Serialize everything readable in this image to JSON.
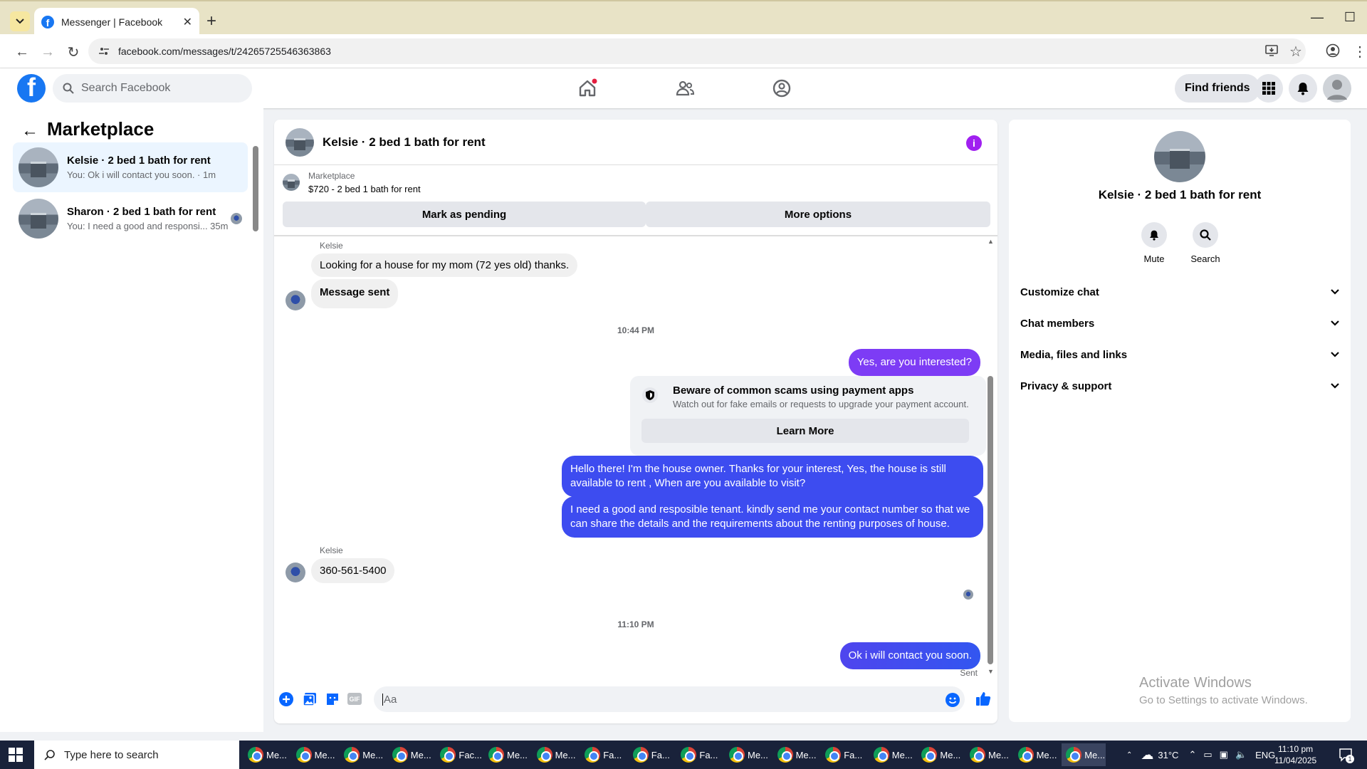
{
  "browser": {
    "tab_title": "Messenger | Facebook",
    "url": "facebook.com/messages/t/24265725546363863"
  },
  "header": {
    "search_placeholder": "Search Facebook",
    "find_friends": "Find friends"
  },
  "sidebar": {
    "title": "Marketplace",
    "conversations": [
      {
        "name": "Kelsie · 2 bed 1 bath for rent",
        "preview": "You: Ok i will contact you soon. · 1m"
      },
      {
        "name": "Sharon · 2 bed 1 bath for rent",
        "preview": "You: I need a good and responsi... 35m"
      }
    ]
  },
  "chat": {
    "title": "Kelsie · 2 bed 1 bath for rent",
    "marketplace_label": "Marketplace",
    "listing": "$720 - 2 bed 1 bath for rent",
    "mark_pending": "Mark as pending",
    "more_options": "More options",
    "sender": "Kelsie",
    "msg1": "Looking for a house for my mom (72 yes old) thanks.",
    "msg2": "Message sent",
    "time1": "10:44 PM",
    "out1": "Yes, are you interested?",
    "scam_title": "Beware of common scams using payment apps",
    "scam_desc": "Watch out for fake emails or requests to upgrade your payment account.",
    "learn_more": "Learn More",
    "out2": "Hello there! I'm the house owner. Thanks for your interest, Yes, the house is still available to rent , When are you available to visit?",
    "out3": "I need a good and resposible tenant.  kindly send me your contact number so that we can share the details and the requirements about the renting purposes of house.",
    "msg3": "360-561-5400",
    "time2": "11:10 PM",
    "out4": "Ok i will contact you soon.",
    "status": "Sent",
    "input_placeholder": "Aa"
  },
  "info_panel": {
    "name": "Kelsie · 2 bed 1 bath for rent",
    "mute": "Mute",
    "search": "Search",
    "sections": [
      "Customize chat",
      "Chat members",
      "Media, files and links",
      "Privacy & support"
    ]
  },
  "watermark": {
    "line1": "Activate Windows",
    "line2": "Go to Settings to activate Windows."
  },
  "taskbar": {
    "search_placeholder": "Type here to search",
    "apps": [
      "Me...",
      "Me...",
      "Me...",
      "Me...",
      "Fac...",
      "Me...",
      "Me...",
      "Fa...",
      "Fa...",
      "Fa...",
      "Me...",
      "Me...",
      "Fa...",
      "Me...",
      "Me...",
      "Me...",
      "Me...",
      "Me..."
    ],
    "temperature": "31°C",
    "language": "ENG",
    "time": "11:10 pm",
    "date": "11/04/2025",
    "notification_count": "1"
  },
  "colors": {
    "fb_blue": "#1877f2",
    "outgoing_purple": "#7d3cf5",
    "outgoing_blue": "#3d4cf0",
    "info_purple": "#a020f0"
  }
}
